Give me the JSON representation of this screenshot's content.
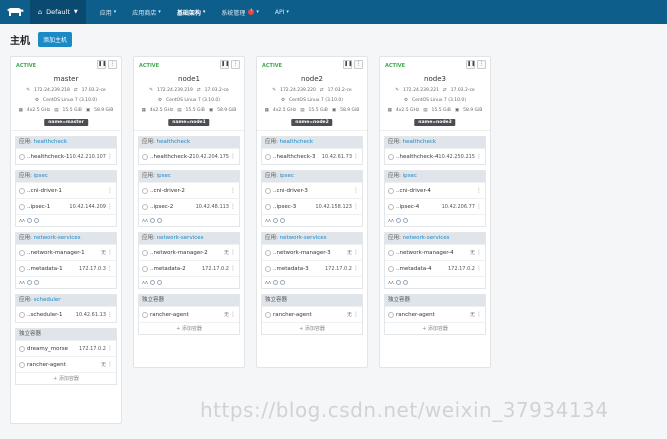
{
  "nav": {
    "environment": "Default",
    "items": [
      {
        "label": "应用",
        "active": false,
        "badge": ""
      },
      {
        "label": "应用商店",
        "active": false,
        "badge": ""
      },
      {
        "label": "基础架构",
        "active": true,
        "badge": ""
      },
      {
        "label": "系统管理",
        "active": false,
        "badge": "!"
      },
      {
        "label": "API",
        "active": false,
        "badge": ""
      }
    ]
  },
  "page": {
    "title": "主机",
    "add_host_label": "添加主机"
  },
  "hosts": [
    {
      "state": "ACTIVE",
      "name": "master",
      "ip": "172.24.239.218",
      "docker": "17.03.2-ce",
      "os": "CentOS Linux 7 (3.10.0)",
      "cpu": "4x2.5 GHz",
      "ram": "15.5 GiB",
      "disk": "58.9 GiB",
      "label": "name=master",
      "stacks": [
        {
          "prefix": "应用:",
          "name": "healthcheck",
          "services": [
            {
              "name": "..healthcheck-1",
              "ip": "10.42.210.107",
              "tag": ""
            }
          ],
          "scale": false
        },
        {
          "prefix": "应用:",
          "name": "ipsec",
          "services": [
            {
              "name": "..cni-driver-1",
              "ip": "",
              "tag": ""
            },
            {
              "name": "..ipsec-1",
              "ip": "10.42.144.209",
              "tag": ""
            }
          ],
          "scale": true
        },
        {
          "prefix": "应用:",
          "name": "network-services",
          "services": [
            {
              "name": "..network-manager-1",
              "ip": "",
              "tag": "无"
            },
            {
              "name": "..metadata-1",
              "ip": "172.17.0.3",
              "tag": ""
            }
          ],
          "scale": true
        },
        {
          "prefix": "应用:",
          "name": "scheduler",
          "services": [
            {
              "name": "..scheduler-1",
              "ip": "10.42.61.13",
              "tag": ""
            }
          ],
          "scale": false
        },
        {
          "prefix": "",
          "name": "独立容器",
          "standalone": true,
          "services": [
            {
              "name": "dreamy_morse",
              "ip": "172.17.0.2",
              "tag": ""
            },
            {
              "name": "rancher-agent",
              "ip": "",
              "tag": "无"
            }
          ],
          "scale": false,
          "add": "+ 添加容器"
        }
      ]
    },
    {
      "state": "ACTIVE",
      "name": "node1",
      "ip": "172.24.239.219",
      "docker": "17.03.2-ce",
      "os": "CentOS Linux 7 (3.10.0)",
      "cpu": "4x2.5 GHz",
      "ram": "15.5 GiB",
      "disk": "58.9 GiB",
      "label": "name=node1",
      "stacks": [
        {
          "prefix": "应用:",
          "name": "healthcheck",
          "services": [
            {
              "name": "..healthcheck-2",
              "ip": "10.42.204.175",
              "tag": ""
            }
          ],
          "scale": false
        },
        {
          "prefix": "应用:",
          "name": "ipsec",
          "services": [
            {
              "name": "..cni-driver-2",
              "ip": "",
              "tag": ""
            },
            {
              "name": "..ipsec-2",
              "ip": "10.42.48.113",
              "tag": ""
            }
          ],
          "scale": true
        },
        {
          "prefix": "应用:",
          "name": "network-services",
          "services": [
            {
              "name": "..network-manager-2",
              "ip": "",
              "tag": "无"
            },
            {
              "name": "..metadata-2",
              "ip": "172.17.0.2",
              "tag": ""
            }
          ],
          "scale": true
        },
        {
          "prefix": "",
          "name": "独立容器",
          "standalone": true,
          "services": [
            {
              "name": "rancher-agent",
              "ip": "",
              "tag": "无"
            }
          ],
          "scale": false,
          "add": "+ 添加容器"
        }
      ]
    },
    {
      "state": "ACTIVE",
      "name": "node2",
      "ip": "172.24.239.220",
      "docker": "17.03.2-ce",
      "os": "CentOS Linux 7 (3.10.0)",
      "cpu": "4x2.5 GHz",
      "ram": "15.5 GiB",
      "disk": "58.9 GiB",
      "label": "name=node2",
      "stacks": [
        {
          "prefix": "应用:",
          "name": "healthcheck",
          "services": [
            {
              "name": "..healthcheck-3",
              "ip": "10.42.61.73",
              "tag": ""
            }
          ],
          "scale": false
        },
        {
          "prefix": "应用:",
          "name": "ipsec",
          "services": [
            {
              "name": "..cni-driver-3",
              "ip": "",
              "tag": ""
            },
            {
              "name": "..ipsec-3",
              "ip": "10.42.158.123",
              "tag": ""
            }
          ],
          "scale": true
        },
        {
          "prefix": "应用:",
          "name": "network-services",
          "services": [
            {
              "name": "..network-manager-3",
              "ip": "",
              "tag": "无"
            },
            {
              "name": "..metadata-3",
              "ip": "172.17.0.2",
              "tag": ""
            }
          ],
          "scale": true
        },
        {
          "prefix": "",
          "name": "独立容器",
          "standalone": true,
          "services": [
            {
              "name": "rancher-agent",
              "ip": "",
              "tag": "无"
            }
          ],
          "scale": false,
          "add": "+ 添加容器"
        }
      ]
    },
    {
      "state": "ACTIVE",
      "name": "node3",
      "ip": "172.24.239.221",
      "docker": "17.03.2-ce",
      "os": "CentOS Linux 7 (3.10.0)",
      "cpu": "4x2.5 GHz",
      "ram": "15.5 GiB",
      "disk": "58.9 GiB",
      "label": "name=node3",
      "stacks": [
        {
          "prefix": "应用:",
          "name": "healthcheck",
          "services": [
            {
              "name": "..healthcheck-4",
              "ip": "10.42.250.215",
              "tag": ""
            }
          ],
          "scale": false
        },
        {
          "prefix": "应用:",
          "name": "ipsec",
          "services": [
            {
              "name": "..cni-driver-4",
              "ip": "",
              "tag": ""
            },
            {
              "name": "..ipsec-4",
              "ip": "10.42.206.77",
              "tag": ""
            }
          ],
          "scale": true
        },
        {
          "prefix": "应用:",
          "name": "network-services",
          "services": [
            {
              "name": "..network-manager-4",
              "ip": "",
              "tag": "无"
            },
            {
              "name": "..metadata-4",
              "ip": "172.17.0.2",
              "tag": ""
            }
          ],
          "scale": true
        },
        {
          "prefix": "",
          "name": "独立容器",
          "standalone": true,
          "services": [
            {
              "name": "rancher-agent",
              "ip": "",
              "tag": "无"
            }
          ],
          "scale": false,
          "add": "+ 添加容器"
        }
      ]
    }
  ],
  "watermark": "https://blog.csdn.net/weixin_37934134"
}
